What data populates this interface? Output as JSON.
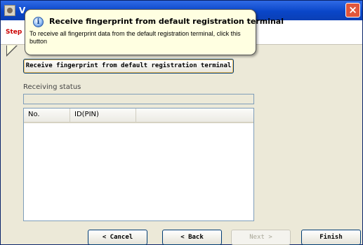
{
  "window": {
    "title": "V",
    "close_glyph": "×",
    "app_icon": "fingerprint-app-icon"
  },
  "step": {
    "label": "Step"
  },
  "receive_button": {
    "label": "Receive fingerprint from default registration terminal"
  },
  "status": {
    "label": "Receiving status",
    "value": ""
  },
  "list": {
    "columns": [
      "No.",
      "ID(PIN)",
      ""
    ],
    "rows": []
  },
  "footer": {
    "cancel_label": "< Cancel",
    "back_label": "< Back",
    "next_label": "Next >",
    "finish_label": "Finish"
  },
  "tooltip": {
    "icon": "info-icon",
    "title": "Receive fingerprint from default registration terminal",
    "body": "To receive all fingerprint data from the default registration terminal, click this button"
  },
  "colors": {
    "titlebar": "#0a46c8",
    "step_text": "#cc0000",
    "tooltip_bg": "#ffffe1",
    "close_button": "#e0563b"
  }
}
